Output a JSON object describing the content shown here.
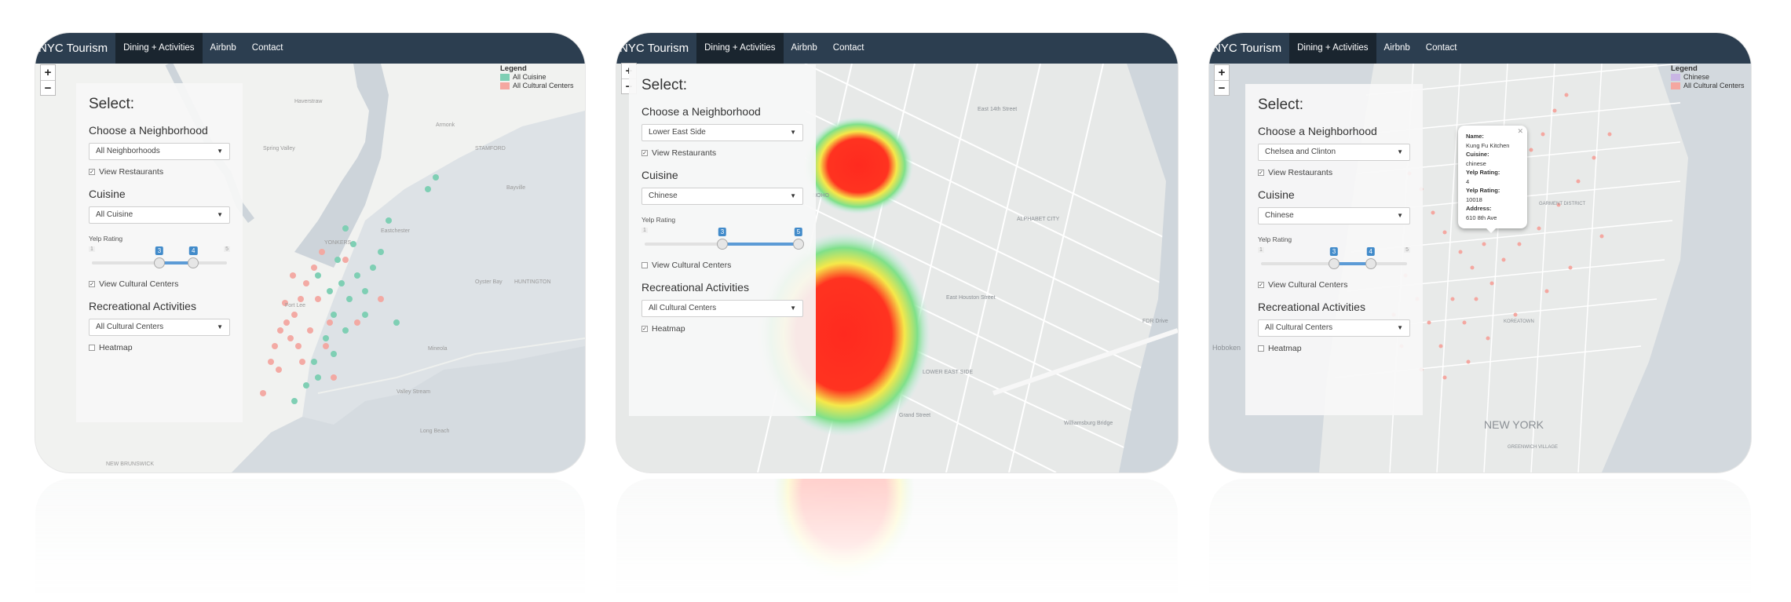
{
  "brand": "NYC Tourism",
  "nav": [
    "Dining + Activities",
    "Airbnb",
    "Contact"
  ],
  "zoom": {
    "in": "+",
    "out": "−"
  },
  "panel": {
    "title": "Select:",
    "neighborhood_label": "Choose a Neighborhood",
    "view_restaurants": "View Restaurants",
    "cuisine_label": "Cuisine",
    "rating_label": "Yelp Rating",
    "view_cultural": "View Cultural Centers",
    "rec_label": "Recreational Activities",
    "heatmap_label": "Heatmap"
  },
  "legend": {
    "title": "Legend"
  },
  "screens": [
    {
      "neighborhood": "All Neighborhoods",
      "cuisine": "All Cuisine",
      "rec": "All Cultural Centers",
      "rating_min": 3,
      "rating_max": 4,
      "scale_min": 1,
      "scale_max": 5,
      "restaurants_checked": true,
      "cultural_checked": true,
      "heatmap_checked": false,
      "legend_items": [
        {
          "label": "All Cuisine",
          "color": "#7fcfb4"
        },
        {
          "label": "All Cultural Centers",
          "color": "#f4a7a0"
        }
      ],
      "map_labels": [
        "STAMFORD",
        "YONKERS",
        "HUNTINGTON",
        "NEW BRUNSWICK",
        "Long Beach",
        "Valley Stream",
        "Mineola",
        "Oyster Bay",
        "Fort Lee",
        "Eastchester",
        "Armonk",
        "Haverstraw",
        "Bayville",
        "Spring Valley"
      ]
    },
    {
      "neighborhood": "Lower East Side",
      "cuisine": "Chinese",
      "rec": "All Cultural Centers",
      "rating_min": 3,
      "rating_max": 5,
      "scale_min": 1,
      "scale_max": 5,
      "restaurants_checked": true,
      "cultural_checked": false,
      "heatmap_checked": true,
      "legend_items": [],
      "map_labels": [
        "ALPHABET CITY",
        "NOHO",
        "LOWER EAST SIDE",
        "FDR Drive",
        "Williamsburg Bridge",
        "East Houston Street",
        "East 14th Street",
        "Grand Street"
      ]
    },
    {
      "neighborhood": "Chelsea and Clinton",
      "cuisine": "Chinese",
      "rec": "All Cultural Centers",
      "rating_min": 3,
      "rating_max": 4,
      "scale_min": 1,
      "scale_max": 5,
      "restaurants_checked": true,
      "cultural_checked": true,
      "heatmap_checked": false,
      "legend_items": [
        {
          "label": "Chinese",
          "color": "#c9b6e4"
        },
        {
          "label": "All Cultural Centers",
          "color": "#f4a7a0"
        }
      ],
      "map_labels": [
        "NEW YORK",
        "Hoboken",
        "KOREATOWN",
        "GARMENT DISTRICT",
        "GREENWICH VILLAGE"
      ],
      "popup": {
        "name_label": "Name:",
        "name": "Kung Fu Kitchen",
        "cuisine_label": "Cuisine:",
        "cuisine": "chinese",
        "rating_label": "Yelp Rating:",
        "rating": "4",
        "zip_label": "Yelp Rating:",
        "zip": "10018",
        "address_label": "Address:",
        "address": "610 8th Ave"
      }
    }
  ]
}
